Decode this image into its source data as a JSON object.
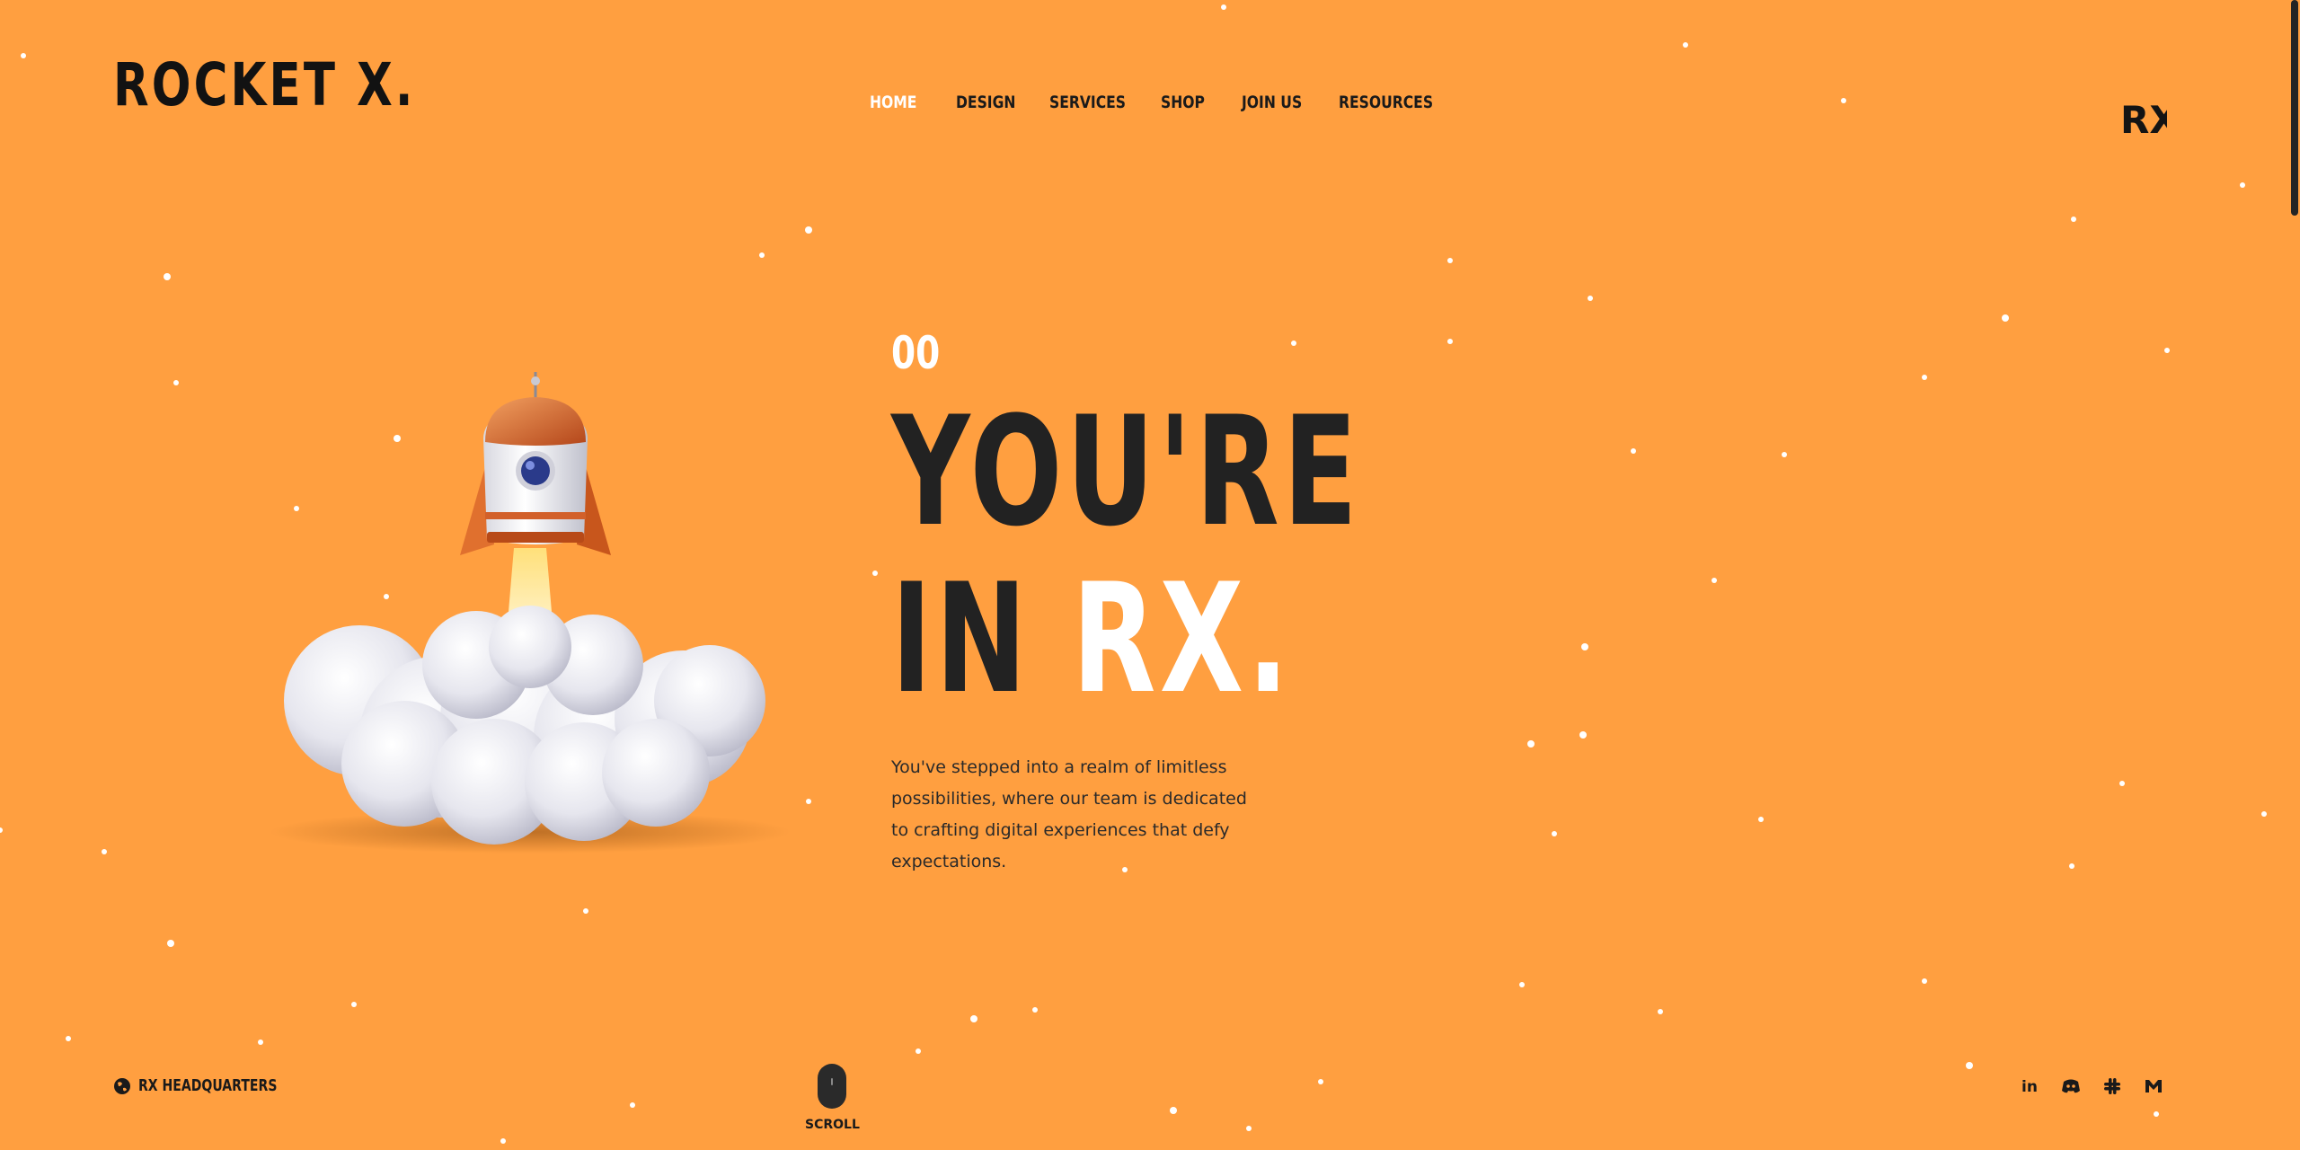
{
  "brand": {
    "logo_text": "ROCKET X.",
    "corner_mark": "RX"
  },
  "nav": {
    "items": [
      {
        "label": "HOME",
        "active": true
      },
      {
        "label": "DESIGN",
        "active": false
      },
      {
        "label": "SERVICES",
        "active": false
      },
      {
        "label": "SHOP",
        "active": false
      },
      {
        "label": "JOIN US",
        "active": false
      },
      {
        "label": "RESOURCES",
        "active": false
      }
    ]
  },
  "hero": {
    "counter": "00",
    "headline_line1": "YOU'RE",
    "headline_line2_prefix": "IN",
    "headline_line2_accent": "RX.",
    "description": "You've stepped into a realm of limitless possibilities, where our team is dedicated to crafting digital experiences that defy expectations."
  },
  "footer": {
    "hq_label": "RX HEADQUARTERS",
    "hq_icon": "globe-icon",
    "scroll_label": "SCROLL",
    "socials": [
      {
        "name": "linkedin-icon",
        "glyph": "in"
      },
      {
        "name": "discord-icon",
        "glyph": ""
      },
      {
        "name": "slack-icon",
        "glyph": ""
      },
      {
        "name": "gmail-icon",
        "glyph": "M"
      }
    ]
  },
  "colors": {
    "background": "#ff9f40",
    "text_dark": "#1e1e1e",
    "accent_white": "#ffffff"
  }
}
